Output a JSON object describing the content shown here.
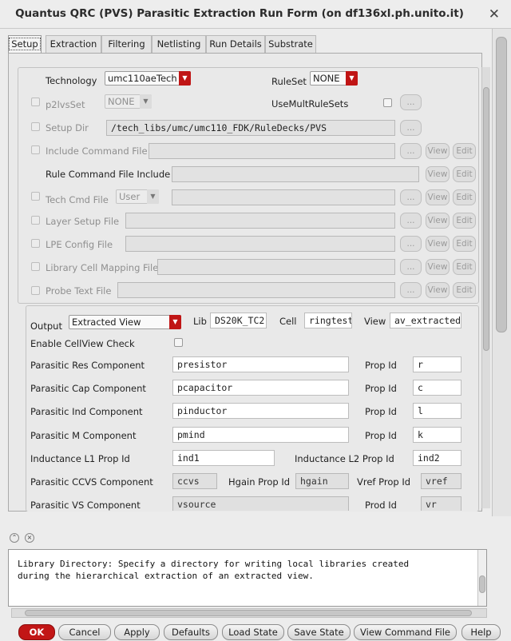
{
  "window": {
    "title": "Quantus QRC (PVS) Parasitic Extraction Run Form (on df136xl.ph.unito.it)",
    "close_glyph": "✕"
  },
  "tabs": [
    "Setup",
    "Extraction",
    "Filtering",
    "Netlisting",
    "Run Details",
    "Substrate"
  ],
  "setup": {
    "technology_label": "Technology",
    "technology_value": "umc110aeTech",
    "ruleset_label": "RuleSet",
    "ruleset_value": "NONE",
    "p2lvsset_label": "p2lvsSet",
    "p2lvsset_value": "NONE",
    "usemultrulesets_label": "UseMultRuleSets",
    "setup_dir_label": "Setup Dir",
    "setup_dir_value": "/tech_libs/umc/umc110_FDK/RuleDecks/PVS",
    "include_command_file_label": "Include Command File",
    "rule_command_file_include_label": "Rule Command File Include",
    "tech_cmd_file_label": "Tech Cmd File",
    "tech_cmd_file_combo": "User",
    "layer_setup_file_label": "Layer Setup File",
    "lpe_config_file_label": "LPE Config File",
    "library_cell_mapping_file_label": "Library Cell Mapping File",
    "probe_text_file_label": "Probe Text File",
    "browse_label": "...",
    "view_label": "View",
    "edit_label": "Edit"
  },
  "output": {
    "output_label": "Output",
    "output_value": "Extracted View",
    "lib_label": "Lib",
    "lib_value": "DS20K_TC2",
    "cell_label": "Cell",
    "cell_value": "ringtest",
    "view_label": "View",
    "view_value": "av_extracted",
    "enable_cellview_check_label": "Enable CellView Check",
    "prop_id_label": "Prop Id",
    "res_label": "Parasitic Res Component",
    "res_value": "presistor",
    "res_prop": "r",
    "cap_label": "Parasitic Cap Component",
    "cap_value": "pcapacitor",
    "cap_prop": "c",
    "ind_label": "Parasitic Ind Component",
    "ind_value": "pinductor",
    "ind_prop": "l",
    "m_label": "Parasitic M Component",
    "m_value": "pmind",
    "m_prop": "k",
    "l1_label": "Inductance L1 Prop Id",
    "l1_value": "ind1",
    "l2_label": "Inductance L2 Prop Id",
    "l2_value": "ind2",
    "ccvs_label": "Parasitic CCVS Component",
    "ccvs_value": "ccvs",
    "hgain_label": "Hgain Prop Id",
    "hgain_value": "hgain",
    "vref_label": "Vref Prop Id",
    "vref_value": "vref",
    "vs_label": "Parasitic VS Component",
    "vs_value": "vsource",
    "vs_prop_label": "Prod Id",
    "vs_prop_value": "vr"
  },
  "help_text": "Library Directory: Specify a directory for writing local libraries created\nduring the hierarchical extraction of an extracted view.",
  "buttons": {
    "ok": "OK",
    "cancel": "Cancel",
    "apply": "Apply",
    "defaults": "Defaults",
    "load_state": "Load State",
    "save_state": "Save State",
    "view_command_file": "View Command File",
    "help": "Help"
  }
}
